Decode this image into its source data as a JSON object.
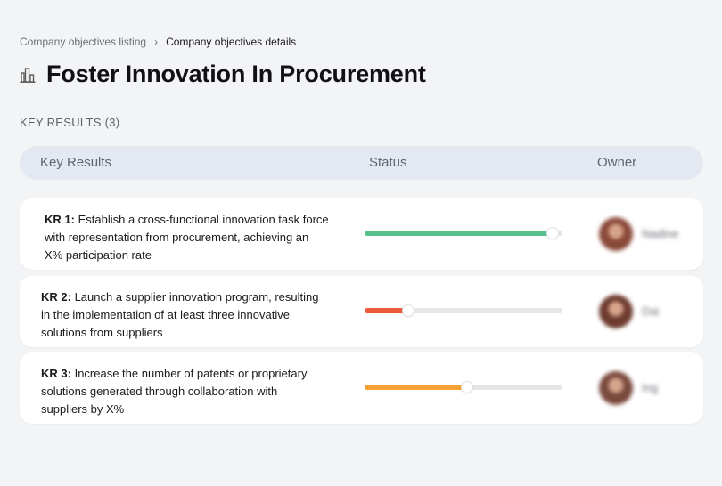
{
  "breadcrumb": {
    "parent": "Company objectives listing",
    "separator": "›",
    "current": "Company objectives details"
  },
  "page": {
    "title_icon": "building-icon",
    "title": "Foster Innovation In Procurement",
    "section_label": "KEY RESULTS (3)"
  },
  "table": {
    "headers": {
      "key_results": "Key Results",
      "status": "Status",
      "owner": "Owner"
    },
    "rows": [
      {
        "id": "KR 1:",
        "text": "Establish a cross-functional innovation task force with representation from procurement, achieving an X% participation rate",
        "progress": 0.95,
        "progress_color": "#56c08d",
        "owner_name": "Nadine",
        "avatar_color": "#8a4a3a"
      },
      {
        "id": "KR 2:",
        "text": "Launch a supplier innovation program, resulting in the implementation of at least three innovative solutions from suppliers",
        "progress": 0.22,
        "progress_color": "#ec5a3a",
        "owner_name": "Dai",
        "avatar_color": "#6e3b2f"
      },
      {
        "id": "KR 3:",
        "text": "Increase the number of patents or proprietary solutions generated through collaboration with suppliers by X%",
        "progress": 0.52,
        "progress_color": "#f4a233",
        "owner_name": "Ing",
        "avatar_color": "#7a4a3e"
      }
    ]
  },
  "colors": {
    "background": "#f3f4f6",
    "header_bg": "#e3e8f1",
    "card_bg": "#ffffff",
    "track": "#e6e6e8"
  }
}
